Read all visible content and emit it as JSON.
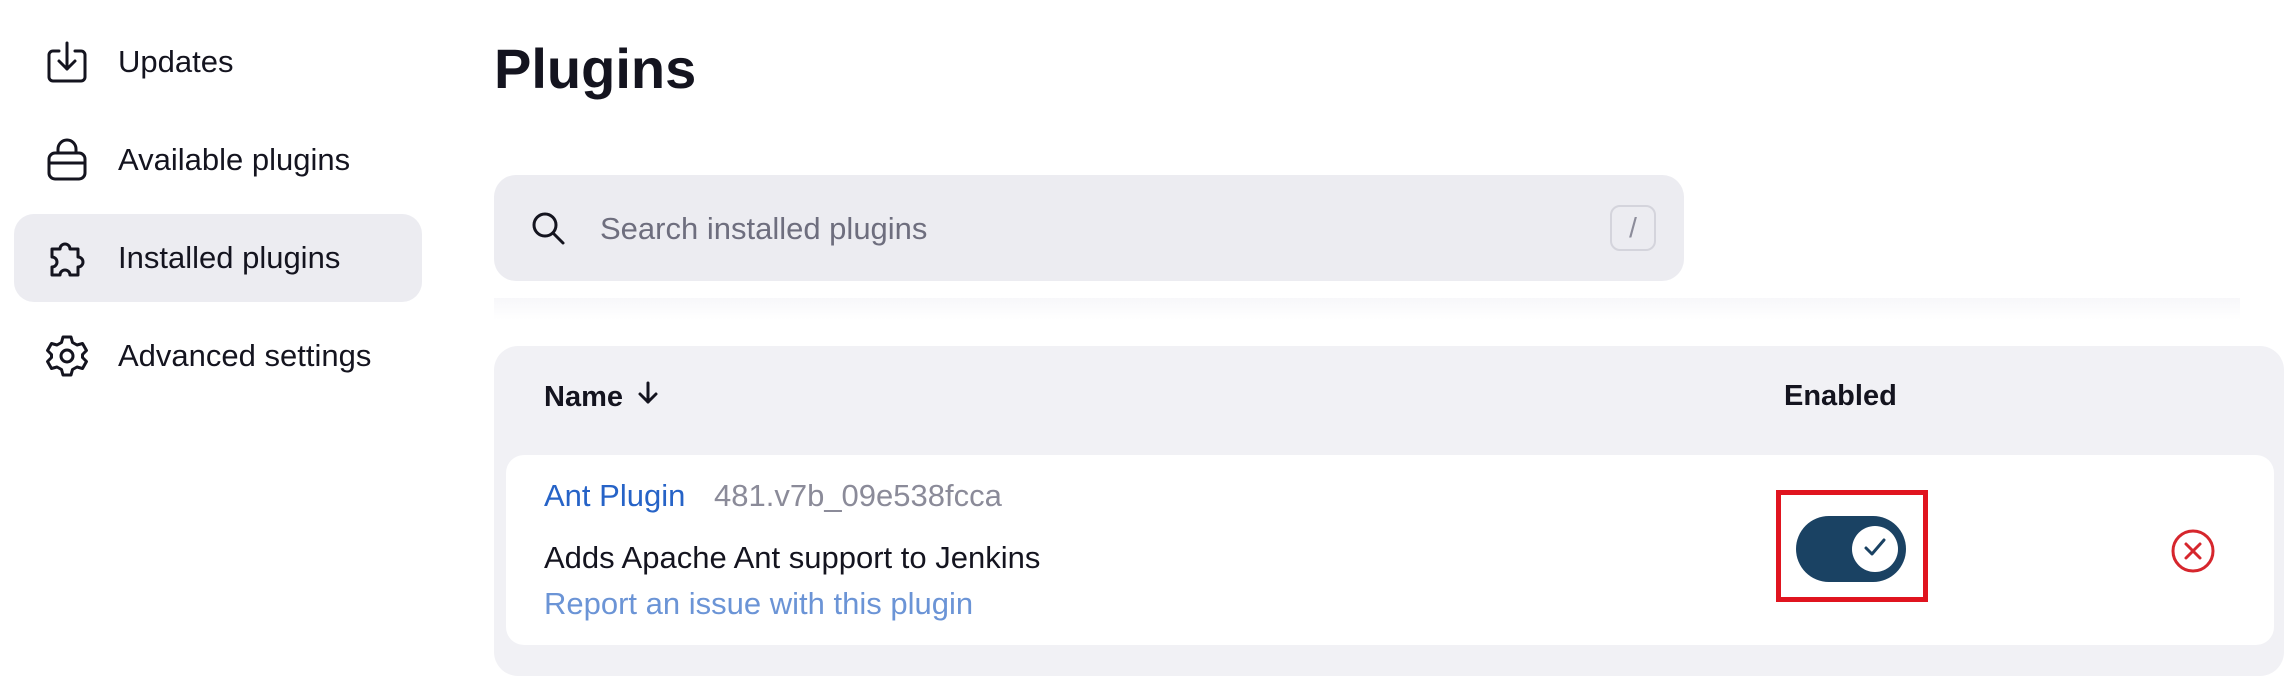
{
  "sidebar": {
    "items": [
      {
        "label": "Updates",
        "icon": "download-icon"
      },
      {
        "label": "Available plugins",
        "icon": "shopping-bag-icon"
      },
      {
        "label": "Installed plugins",
        "icon": "puzzle-icon",
        "active": true
      },
      {
        "label": "Advanced settings",
        "icon": "gear-icon"
      }
    ]
  },
  "page": {
    "title": "Plugins"
  },
  "search": {
    "placeholder": "Search installed plugins",
    "value": "",
    "shortcut": "/"
  },
  "table": {
    "columns": [
      {
        "label": "Name",
        "sort": "descending"
      },
      {
        "label": "Enabled"
      }
    ],
    "rows": [
      {
        "name": "Ant Plugin",
        "version": "481.v7b_09e538fcca",
        "description": "Adds Apache Ant support to Jenkins",
        "report_link": "Report an issue with this plugin",
        "enabled": true
      }
    ]
  },
  "colors": {
    "accent_link": "#2663c7",
    "toggle_on": "#1a4263",
    "highlight": "#e0141f",
    "danger": "#d6262d"
  }
}
